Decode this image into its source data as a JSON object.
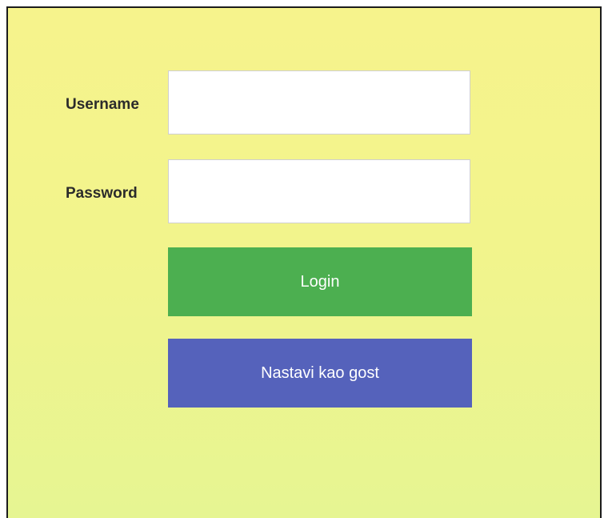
{
  "form": {
    "username": {
      "label": "Username",
      "value": "",
      "placeholder": ""
    },
    "password": {
      "label": "Password",
      "value": "",
      "placeholder": ""
    },
    "login_label": "Login",
    "guest_label": "Nastavi kao gost"
  },
  "colors": {
    "background_top": "#f6f38c",
    "background_bottom": "#e6f592",
    "login_button": "#4caf50",
    "guest_button": "#5562bb",
    "label_text": "#2b2b2b",
    "border": "#1c1c1c"
  }
}
